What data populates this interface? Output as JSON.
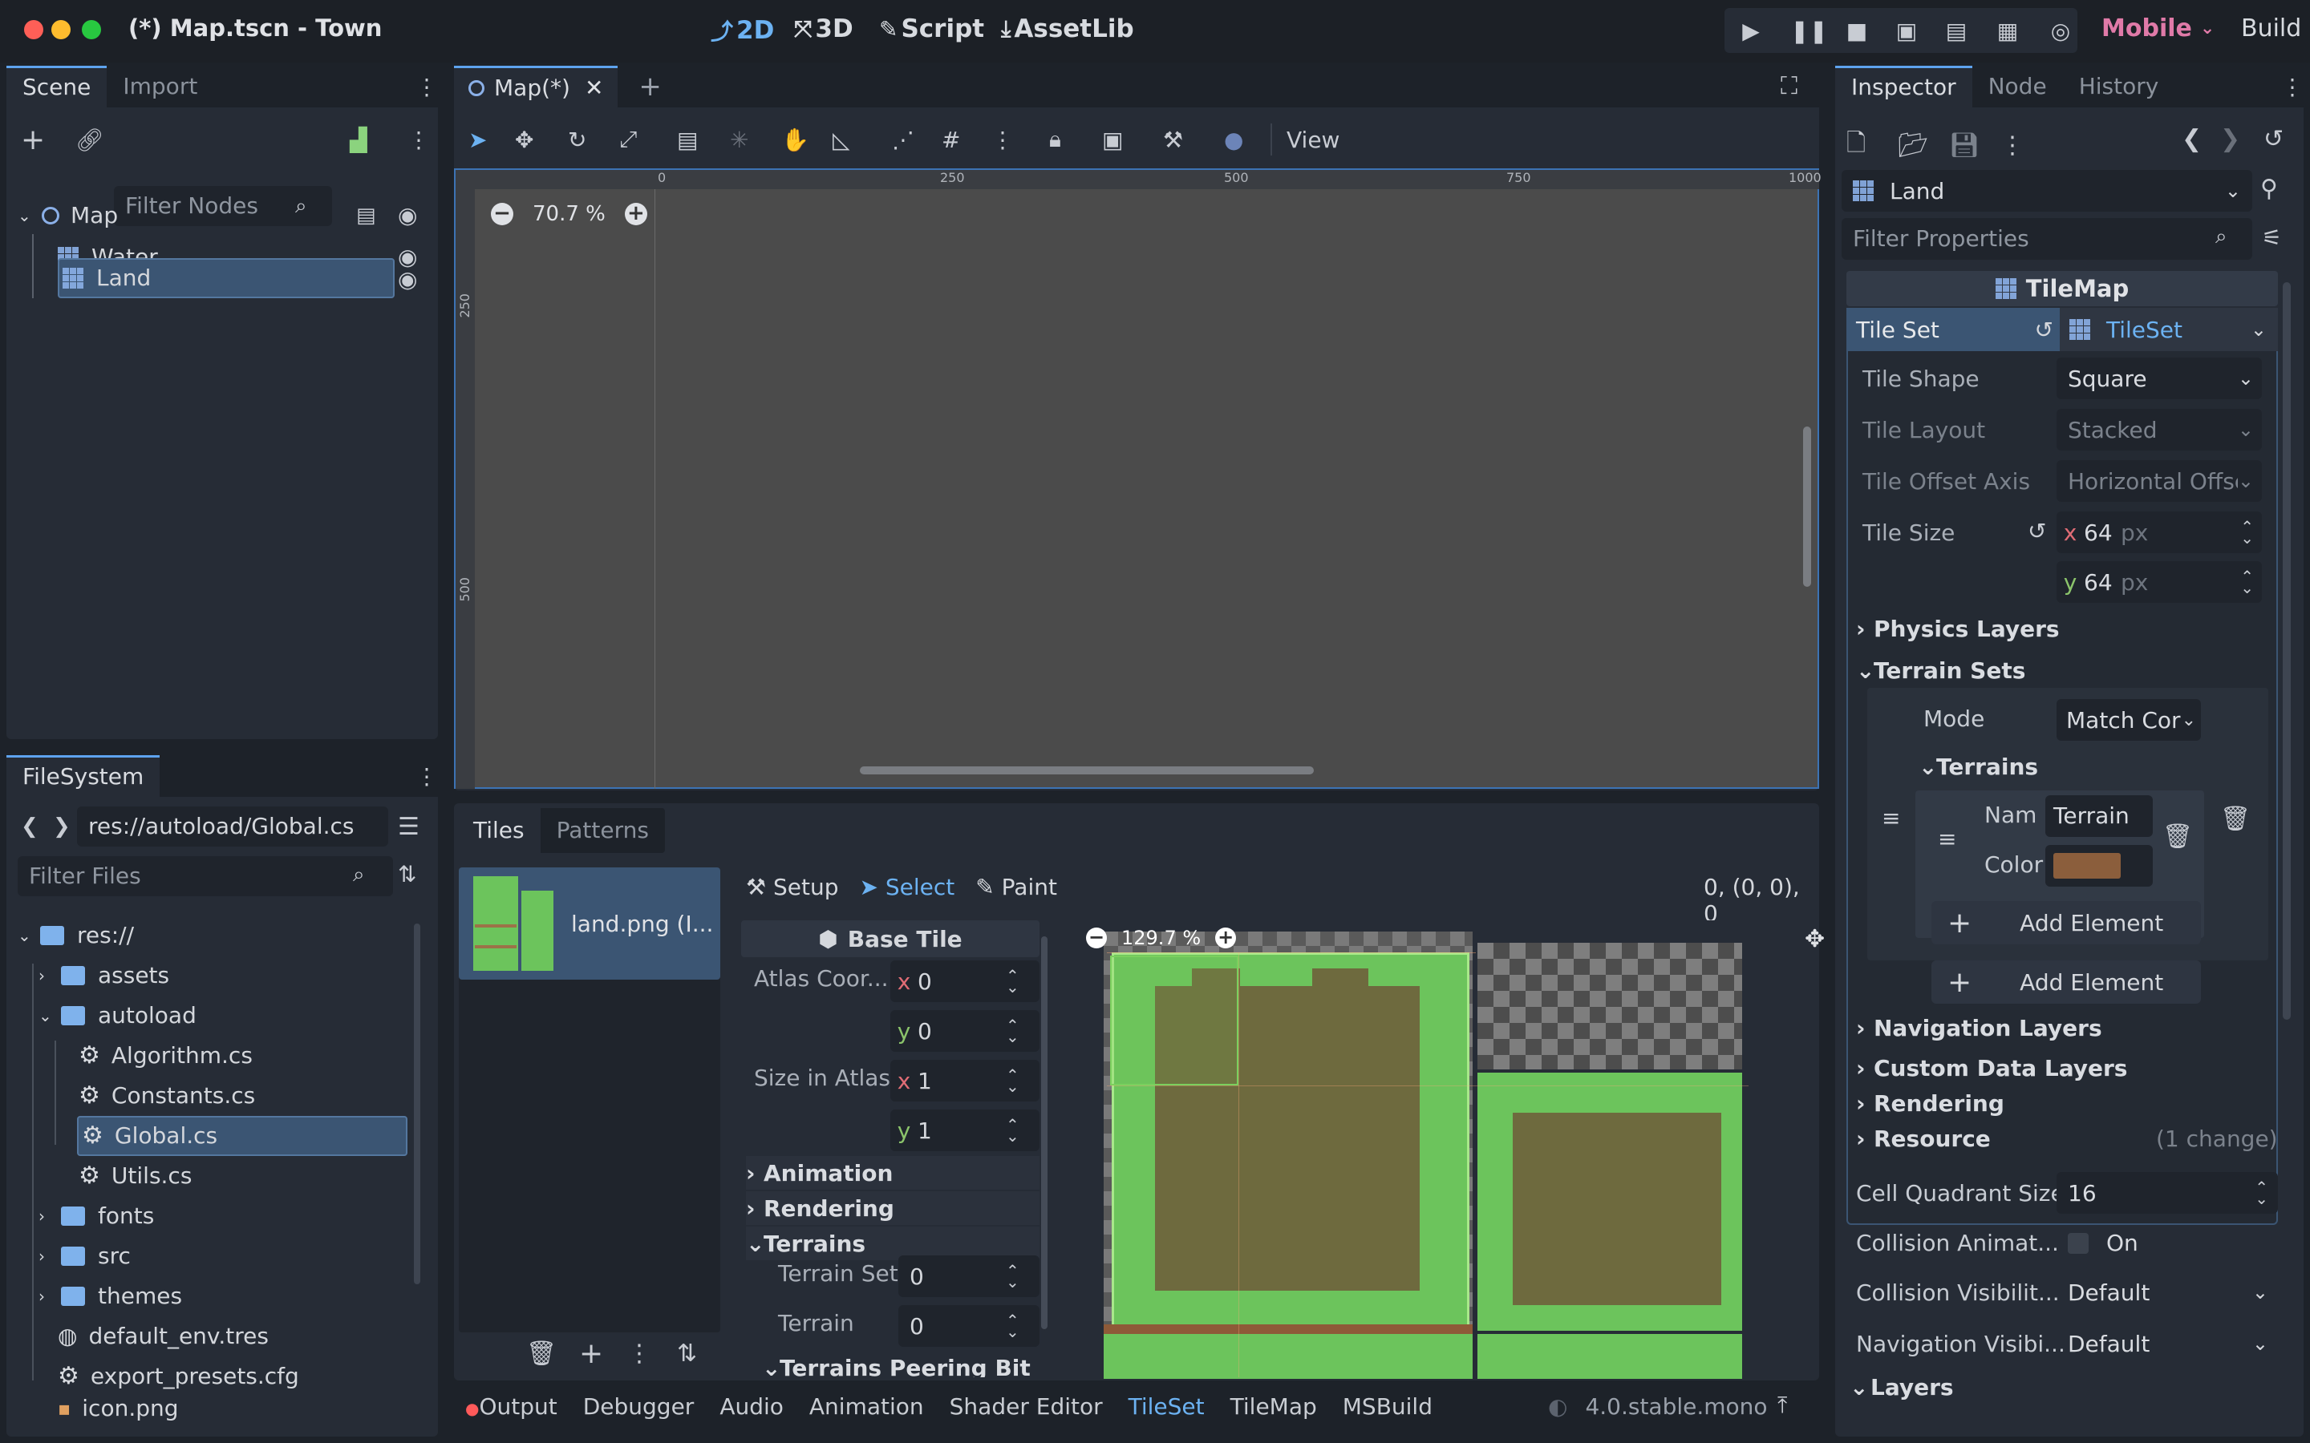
{
  "window": {
    "title": "(*) Map.tscn - Town"
  },
  "workspaces": [
    {
      "label": "2D",
      "active": true
    },
    {
      "label": "3D",
      "active": false
    },
    {
      "label": "Script",
      "active": false
    },
    {
      "label": "AssetLib",
      "active": false
    }
  ],
  "run": {
    "renderer": "Mobile",
    "build": "Build"
  },
  "scene_dock": {
    "tabs": [
      "Scene",
      "Import"
    ],
    "filter_placeholder": "Filter Nodes",
    "nodes": [
      {
        "name": "Map",
        "icon": "node2d-icon"
      },
      {
        "name": "Water",
        "icon": "tilemap-icon"
      },
      {
        "name": "Land",
        "icon": "tilemap-icon",
        "selected": true
      }
    ]
  },
  "filesystem": {
    "tab": "FileSystem",
    "path": "res://autoload/Global.cs",
    "filter_placeholder": "Filter Files",
    "items": [
      {
        "name": "res://",
        "type": "folder",
        "level": 0,
        "expanded": true
      },
      {
        "name": "assets",
        "type": "folder",
        "level": 1,
        "expanded": false
      },
      {
        "name": "autoload",
        "type": "folder",
        "level": 1,
        "expanded": true
      },
      {
        "name": "Algorithm.cs",
        "type": "script",
        "level": 2
      },
      {
        "name": "Constants.cs",
        "type": "script",
        "level": 2
      },
      {
        "name": "Global.cs",
        "type": "script",
        "level": 2,
        "selected": true
      },
      {
        "name": "Utils.cs",
        "type": "script",
        "level": 2
      },
      {
        "name": "fonts",
        "type": "folder",
        "level": 1,
        "expanded": false
      },
      {
        "name": "src",
        "type": "folder",
        "level": 1,
        "expanded": false
      },
      {
        "name": "themes",
        "type": "folder",
        "level": 1,
        "expanded": false
      },
      {
        "name": "default_env.tres",
        "type": "env",
        "level": 1
      },
      {
        "name": "export_presets.cfg",
        "type": "config",
        "level": 1
      },
      {
        "name": "icon.png",
        "type": "image",
        "level": 1
      }
    ]
  },
  "viewport": {
    "tab": "Map(*)",
    "zoom": "70.7 %",
    "view_menu": "View",
    "ruler_x": [
      "0",
      "250",
      "500",
      "750",
      "1000"
    ],
    "ruler_y": [
      "250",
      "500"
    ]
  },
  "tileset_panel": {
    "tabs": [
      "Tiles",
      "Patterns"
    ],
    "source_name": "land.png (I...",
    "modes": [
      "Setup",
      "Select",
      "Paint"
    ],
    "active_mode": "Select",
    "coords": "0, (0, 0), 0",
    "base_tile": "Base Tile",
    "atlas_coords_label": "Atlas Coor...",
    "atlas_x": "0",
    "atlas_y": "0",
    "size_label": "Size in Atlas",
    "size_x": "1",
    "size_y": "1",
    "sections": [
      "Animation",
      "Rendering",
      "Terrains"
    ],
    "terrain_set_label": "Terrain Set",
    "terrain_set": "0",
    "terrain_label": "Terrain",
    "terrain": "0",
    "peering_label": "Terrains Peering Bit",
    "atlas_zoom": "129.7 %"
  },
  "inspector": {
    "tabs": [
      "Inspector",
      "Node",
      "History"
    ],
    "object": "Land",
    "filter_placeholder": "Filter Properties",
    "class_header": "TileMap",
    "tile_set_label": "Tile Set",
    "tile_set_value": "TileSet",
    "tile_shape_label": "Tile Shape",
    "tile_shape": "Square",
    "tile_layout_label": "Tile Layout",
    "tile_layout": "Stacked",
    "offset_axis_label": "Tile Offset Axis",
    "offset_axis": "Horizontal Offset",
    "tile_size_label": "Tile Size",
    "tile_size_x": "64",
    "tile_size_y": "64",
    "unit": "px",
    "physics_layers": "Physics Layers",
    "terrain_sets": "Terrain Sets",
    "mode_label": "Mode",
    "mode": "Match Corners",
    "terrains": "Terrains",
    "name_label": "Nam",
    "name_value": "Terrain",
    "color_label": "Color",
    "color_value": "#8b5e3c",
    "add_element": "Add Element",
    "navigation_layers": "Navigation Layers",
    "custom_data_layers": "Custom Data Layers",
    "rendering": "Rendering",
    "resource": "Resource",
    "resource_changes": "(1 change)",
    "cell_quadrant_label": "Cell Quadrant Size",
    "cell_quadrant": "16",
    "collision_anim_label": "Collision Animat...",
    "collision_anim": "On",
    "collision_vis_label": "Collision Visibilit...",
    "collision_vis": "Default",
    "nav_vis_label": "Navigation Visibi...",
    "nav_vis": "Default",
    "layers": "Layers"
  },
  "bottom_bar": {
    "tabs": [
      "Output",
      "Debugger",
      "Audio",
      "Animation",
      "Shader Editor",
      "TileSet",
      "TileMap",
      "MSBuild"
    ],
    "active": "TileSet",
    "version": "4.0.stable.mono"
  },
  "colors": {
    "accent": "#5ea3ef",
    "selection": "#3b5573",
    "grass": "#6cc45c",
    "dirt": "#6e6a3e",
    "renderer": "#e07aa8"
  }
}
